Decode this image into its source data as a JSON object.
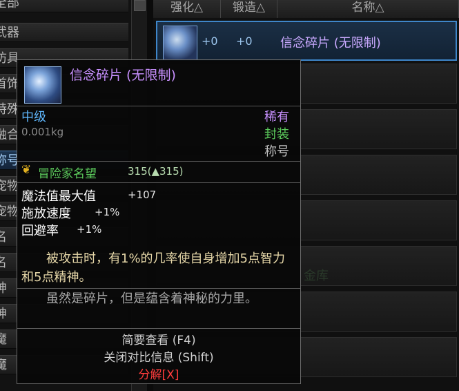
{
  "left_list": {
    "items": [
      {
        "label": "全部",
        "active": false
      },
      {
        "label": "武器",
        "active": false
      },
      {
        "label": "防具",
        "active": false
      },
      {
        "label": "首饰",
        "active": false
      },
      {
        "label": "特殊",
        "active": false
      },
      {
        "label": "融合",
        "active": false
      },
      {
        "label": "称号",
        "active": true
      },
      {
        "label": "宠物",
        "active": false
      },
      {
        "label": "宠物",
        "active": false
      },
      {
        "label": "名",
        "active": false
      },
      {
        "label": "名",
        "active": false
      },
      {
        "label": "神",
        "active": false
      },
      {
        "label": "神",
        "active": false
      },
      {
        "label": "魔",
        "active": false
      },
      {
        "label": "魔",
        "active": false
      }
    ]
  },
  "right_list": {
    "headers": {
      "reinforce": "强化△",
      "forge": "锻造△",
      "name": "名称△"
    },
    "rows": [
      {
        "reinforce": "+0",
        "forge": "+0",
        "name": "信念碎片 (无限制)",
        "selected": true
      }
    ],
    "watermark": "金库"
  },
  "tooltip": {
    "item_name": "信念碎片 (无限制)",
    "grade": "中级",
    "weight": "0.001kg",
    "rarity": "稀有",
    "sealed": "封装",
    "type": "称号",
    "fame_label": "冒险家名望",
    "fame_value": "315(▲315)",
    "stats": [
      {
        "label": "魔法值最大值",
        "value": "+107"
      },
      {
        "label": "施放速度",
        "value": "+1%"
      },
      {
        "label": "回避率",
        "value": "+1%"
      }
    ],
    "effect_text": "　　被攻击时，有1%的几率使自身增加5点智力和5点精神。",
    "flavor_text": "　　虽然是碎片，但是蕴含着神秘的力里。",
    "footer": {
      "brief_view": "简要查看 (F4)",
      "close_compare": "关闭对比信息 (Shift)",
      "disassemble": "分解[X]"
    },
    "colors": {
      "name": "#c890ff",
      "grade": "#5fb8ff",
      "sealed": "#5ccc5c",
      "effect": "#e6d7a8",
      "disassemble": "#ff3c3c"
    }
  }
}
